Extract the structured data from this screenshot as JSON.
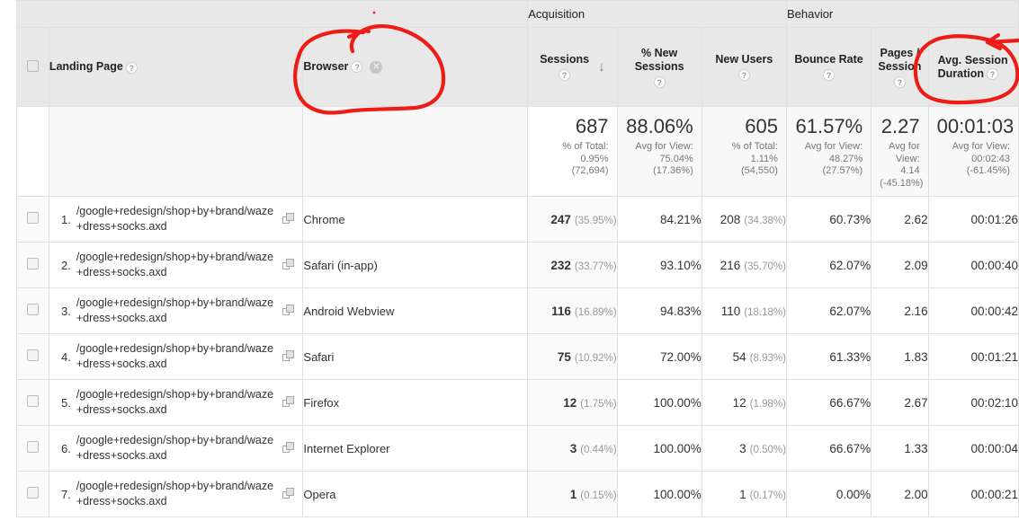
{
  "table": {
    "group_headers": [
      {
        "label": "",
        "span": 3
      },
      {
        "label": "Acquisition",
        "span": 3
      },
      {
        "label": "Behavior",
        "span": 3
      }
    ],
    "acquisition_label": "Acquisition",
    "behavior_label": "Behavior",
    "dimension_headers": {
      "landing_page": "Landing Page",
      "browser": "Browser",
      "browser_remove_icon": "close-circle-icon",
      "help_icon": "?"
    },
    "metric_headers": [
      {
        "label": "Sessions",
        "sorted": true,
        "sort_dir": "desc",
        "sort_glyph": "↓"
      },
      {
        "label": "% New Sessions",
        "line1": "% New",
        "line2": "Sessions"
      },
      {
        "label": "New Users"
      },
      {
        "label": "Bounce Rate"
      },
      {
        "label": "Pages / Session",
        "line1": "Pages /",
        "line2": "Session"
      },
      {
        "label": "Avg. Session Duration",
        "line1": "Avg. Session",
        "line2": "Duration"
      }
    ],
    "summary": [
      {
        "value": "687",
        "sub": [
          "% of Total:",
          "0.95%",
          "(72,694)"
        ]
      },
      {
        "value": "88.06%",
        "sub": [
          "Avg for View:",
          "75.04%",
          "(17.36%)"
        ]
      },
      {
        "value": "605",
        "sub": [
          "% of Total:",
          "1.11%",
          "(54,550)"
        ]
      },
      {
        "value": "61.57%",
        "sub": [
          "Avg for View:",
          "48.27%",
          "(27.57%)"
        ]
      },
      {
        "value": "2.27",
        "sub": [
          "Avg for",
          "View:",
          "4.14",
          "(-45.18%)"
        ]
      },
      {
        "value": "00:01:03",
        "sub": [
          "Avg for View:",
          "00:02:43",
          "(-61.45%)"
        ]
      }
    ],
    "rows": [
      {
        "index": "1.",
        "landing_page": "/google+redesign/shop+by+brand/waze+dress+socks.axd",
        "browser": "Chrome",
        "sessions": "247",
        "sessions_pct": "(35.95%)",
        "new_sessions_pct": "84.21%",
        "new_users": "208",
        "new_users_pct": "(34.38%)",
        "bounce_rate": "60.73%",
        "pages_per_session": "2.62",
        "avg_session_duration": "00:01:26"
      },
      {
        "index": "2.",
        "landing_page": "/google+redesign/shop+by+brand/waze+dress+socks.axd",
        "browser": "Safari (in-app)",
        "sessions": "232",
        "sessions_pct": "(33.77%)",
        "new_sessions_pct": "93.10%",
        "new_users": "216",
        "new_users_pct": "(35.70%)",
        "bounce_rate": "62.07%",
        "pages_per_session": "2.09",
        "avg_session_duration": "00:00:40"
      },
      {
        "index": "3.",
        "landing_page": "/google+redesign/shop+by+brand/waze+dress+socks.axd",
        "browser": "Android Webview",
        "sessions": "116",
        "sessions_pct": "(16.89%)",
        "new_sessions_pct": "94.83%",
        "new_users": "110",
        "new_users_pct": "(18.18%)",
        "bounce_rate": "62.07%",
        "pages_per_session": "2.16",
        "avg_session_duration": "00:00:42"
      },
      {
        "index": "4.",
        "landing_page": "/google+redesign/shop+by+brand/waze+dress+socks.axd",
        "browser": "Safari",
        "sessions": "75",
        "sessions_pct": "(10.92%)",
        "new_sessions_pct": "72.00%",
        "new_users": "54",
        "new_users_pct": "(8.93%)",
        "bounce_rate": "61.33%",
        "pages_per_session": "1.83",
        "avg_session_duration": "00:01:21"
      },
      {
        "index": "5.",
        "landing_page": "/google+redesign/shop+by+brand/waze+dress+socks.axd",
        "browser": "Firefox",
        "sessions": "12",
        "sessions_pct": "(1.75%)",
        "new_sessions_pct": "100.00%",
        "new_users": "12",
        "new_users_pct": "(1.98%)",
        "bounce_rate": "66.67%",
        "pages_per_session": "2.67",
        "avg_session_duration": "00:02:10"
      },
      {
        "index": "6.",
        "landing_page": "/google+redesign/shop+by+brand/waze+dress+socks.axd",
        "browser": "Internet Explorer",
        "sessions": "3",
        "sessions_pct": "(0.44%)",
        "new_sessions_pct": "100.00%",
        "new_users": "3",
        "new_users_pct": "(0.50%)",
        "bounce_rate": "66.67%",
        "pages_per_session": "1.33",
        "avg_session_duration": "00:00:04"
      },
      {
        "index": "7.",
        "landing_page": "/google+redesign/shop+by+brand/waze+dress+socks.axd",
        "browser": "Opera",
        "sessions": "1",
        "sessions_pct": "(0.15%)",
        "new_sessions_pct": "100.00%",
        "new_users": "1",
        "new_users_pct": "(0.17%)",
        "bounce_rate": "0.00%",
        "pages_per_session": "2.00",
        "avg_session_duration": "00:00:21"
      }
    ]
  },
  "annotations": {
    "color": "#ee1c16",
    "marks": [
      {
        "name": "browser-header-circle",
        "target": "Browser"
      },
      {
        "name": "avg-session-duration-circle",
        "target": "Avg. Session Duration"
      }
    ]
  }
}
